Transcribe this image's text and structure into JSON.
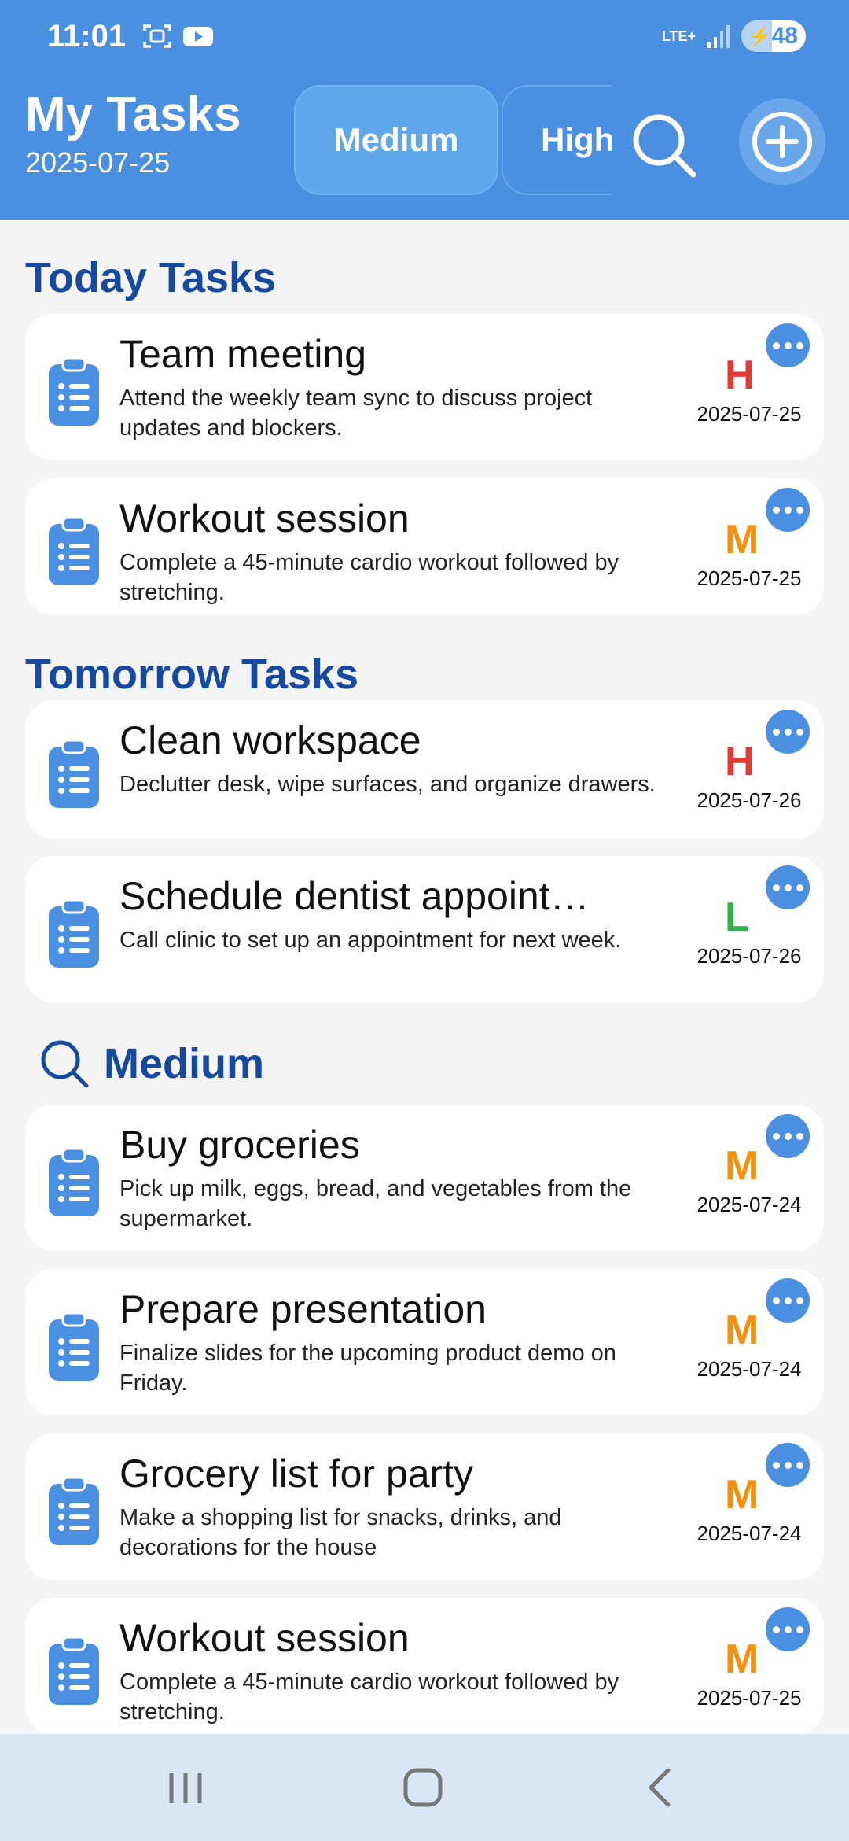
{
  "status_bar": {
    "time": "11:01",
    "network": "LTE+",
    "battery": "48",
    "battery_level": 0.48,
    "icons": [
      "screenshot-icon",
      "youtube-icon",
      "signal-icon",
      "battery-charging-icon"
    ]
  },
  "header": {
    "title": "My Tasks",
    "date": "2025-07-25",
    "filters": [
      {
        "label": "Medium",
        "active": true
      },
      {
        "label": "High",
        "active": false
      }
    ],
    "search_icon": "search-icon",
    "add_icon": "plus-circle-icon"
  },
  "colors": {
    "primary": "#4a8fe0",
    "section_title": "#1749a0",
    "priority_high": "#e53935",
    "priority_medium": "#f5900a",
    "priority_low": "#34b04a"
  },
  "today": {
    "title": "Today Tasks",
    "tasks": [
      {
        "title": "Team meeting",
        "description": "Attend the weekly team sync to discuss project updates and blockers.",
        "priority": "H",
        "date": "2025-07-25"
      },
      {
        "title": "Workout session",
        "description": "Complete a 45-minute cardio workout followed by stretching.",
        "priority": "M",
        "date": "2025-07-25"
      }
    ]
  },
  "tomorrow": {
    "title": "Tomorrow Tasks",
    "tasks": [
      {
        "title": "Clean workspace",
        "description": "Declutter desk, wipe surfaces, and organize drawers.",
        "priority": "H",
        "date": "2025-07-26"
      },
      {
        "title": "Schedule dentist appoint…",
        "description": "Call clinic to set up an appointment for next week.",
        "priority": "L",
        "date": "2025-07-26"
      }
    ]
  },
  "filtered": {
    "title": "Medium",
    "icon": "search-icon",
    "tasks": [
      {
        "title": "Buy groceries",
        "description": "Pick up milk, eggs, bread, and vegetables from the supermarket.",
        "priority": "M",
        "date": "2025-07-24"
      },
      {
        "title": "Prepare presentation",
        "description": "Finalize slides for the upcoming product demo on Friday.",
        "priority": "M",
        "date": "2025-07-24"
      },
      {
        "title": "Grocery list for party",
        "description": "Make a shopping list for snacks, drinks, and decorations for the house",
        "priority": "M",
        "date": "2025-07-24"
      },
      {
        "title": "Workout session",
        "description": "Complete a 45-minute cardio workout followed by stretching.",
        "priority": "M",
        "date": "2025-07-25"
      }
    ]
  },
  "navbar": {
    "icons": [
      "recent-apps-icon",
      "home-icon",
      "back-icon"
    ]
  }
}
